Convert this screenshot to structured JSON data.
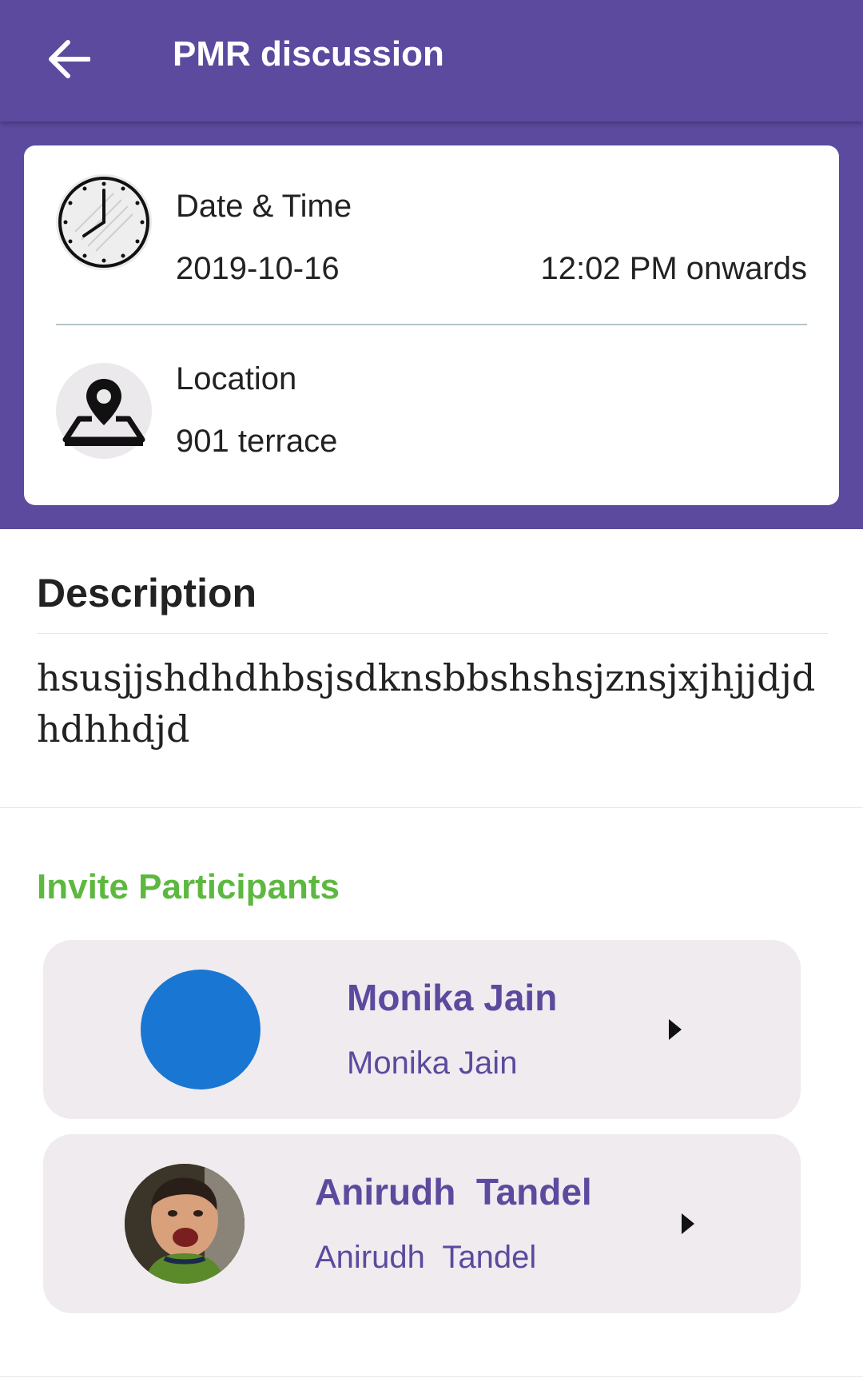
{
  "app_bar": {
    "title": "PMR discussion",
    "back_icon": "arrow-left-icon"
  },
  "colors": {
    "primary": "#5b4a9e",
    "accent_green": "#5db83f",
    "card_bg": "#efebef",
    "avatar_blue": "#1976d2"
  },
  "details": {
    "date_time": {
      "label": "Date & Time",
      "date": "2019-10-16",
      "time": "12:02 PM onwards",
      "icon": "clock-icon"
    },
    "location": {
      "label": "Location",
      "value": "901 terrace",
      "icon": "map-pin-icon"
    }
  },
  "description": {
    "title": "Description",
    "text": "hsusjjshdhdhbsjsdknsbbshshsjznsjxjhjjdjd hdhhdjd"
  },
  "invite": {
    "title": "Invite Participants",
    "participants": [
      {
        "name": "Monika Jain",
        "subtitle": "Monika Jain"
      },
      {
        "name": "Anirudh  Tandel",
        "subtitle": "Anirudh  Tandel"
      }
    ]
  }
}
